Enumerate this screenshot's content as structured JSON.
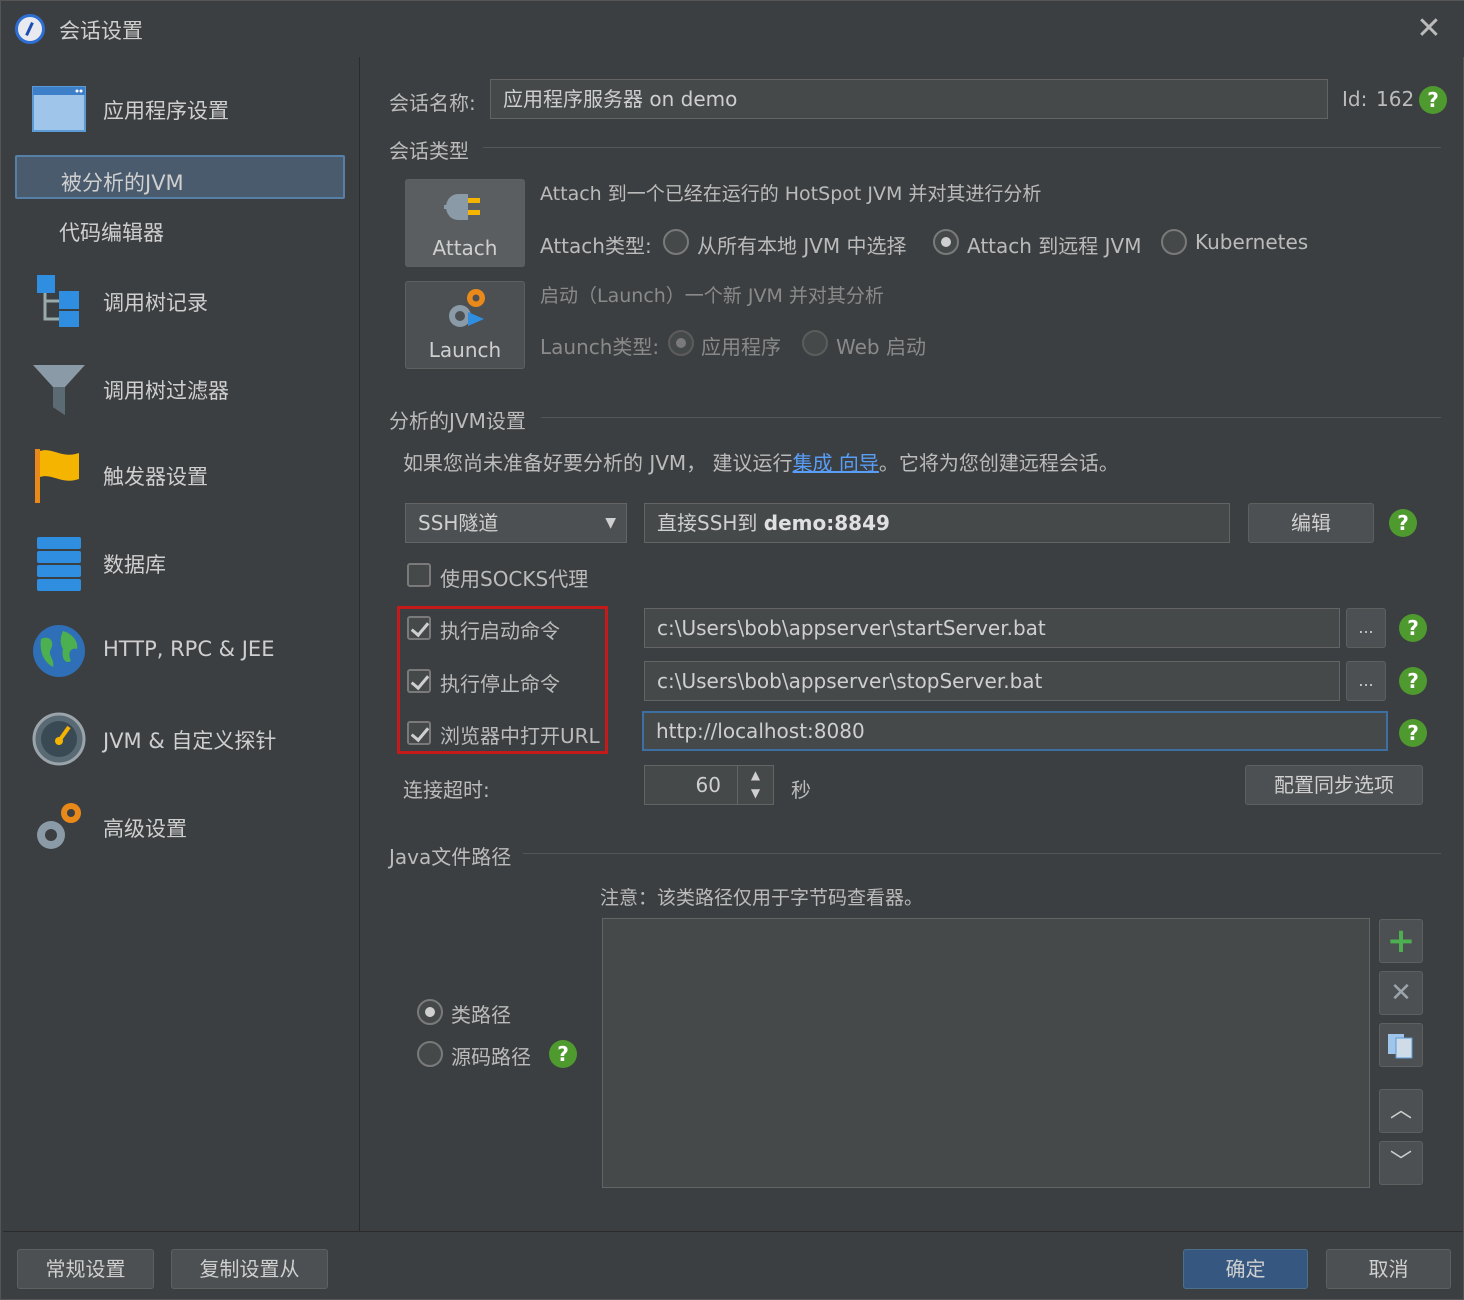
{
  "window": {
    "title": "会话设置",
    "close": "✕"
  },
  "sidebar": {
    "items": [
      {
        "label": "应用程序设置"
      },
      {
        "label": "被分析的JVM"
      },
      {
        "label": "代码编辑器"
      },
      {
        "label": "调用树记录"
      },
      {
        "label": "调用树过滤器"
      },
      {
        "label": "触发器设置"
      },
      {
        "label": "数据库"
      },
      {
        "label": "HTTP, RPC & JEE"
      },
      {
        "label": "JVM & 自定义探针"
      },
      {
        "label": "高级设置"
      }
    ]
  },
  "session": {
    "name_label": "会话名称:",
    "name_value": "应用程序服务器 on demo",
    "id_label": "Id:",
    "id_value": "162"
  },
  "session_type": {
    "section_title": "会话类型",
    "attach_button": "Attach",
    "launch_button": "Launch",
    "attach_desc": "Attach 到一个已经在运行的 HotSpot JVM 并对其进行分析",
    "attach_type_label": "Attach类型:",
    "attach_options": [
      "从所有本地 JVM 中选择",
      "Attach 到远程 JVM",
      "Kubernetes"
    ],
    "launch_desc": "启动（Launch）一个新 JVM 并对其分析",
    "launch_type_label": "Launch类型:",
    "launch_options": [
      "应用程序",
      "Web 启动"
    ]
  },
  "jvm_settings": {
    "section_title": "分析的JVM设置",
    "hint_prefix": "如果您尚未准备好要分析的 JVM， 建议运行",
    "hint_link": "集成 向导",
    "hint_suffix": "。它将为您创建远程会话。",
    "connection_type": "SSH隧道",
    "connection_prefix": "直接SSH到 ",
    "connection_target": "demo:8849",
    "edit_button": "编辑",
    "socks_label": "使用SOCKS代理",
    "start_cmd_label": "执行启动命令",
    "start_cmd_value": "c:\\Users\\bob\\appserver\\startServer.bat",
    "stop_cmd_label": "执行停止命令",
    "stop_cmd_value": "c:\\Users\\bob\\appserver\\stopServer.bat",
    "browser_label": "浏览器中打开URL",
    "browser_value": "http://localhost:8080",
    "browse_button": "...",
    "timeout_label": "连接超时:",
    "timeout_value": "60",
    "timeout_unit": "秒",
    "sync_button": "配置同步选项"
  },
  "java_paths": {
    "section_title": "Java文件路径",
    "note": "注意：该类路径仅用于字节码查看器。",
    "classpath_label": "类路径",
    "sourcepath_label": "源码路径"
  },
  "footer": {
    "general_button": "常规设置",
    "copy_button": "复制设置从",
    "ok_button": "确定",
    "cancel_button": "取消"
  },
  "help_glyph": "?",
  "colors": {
    "accent": "#365880",
    "help": "#4f9a2f",
    "highlight": "#c41a1a",
    "link": "#589df6"
  }
}
